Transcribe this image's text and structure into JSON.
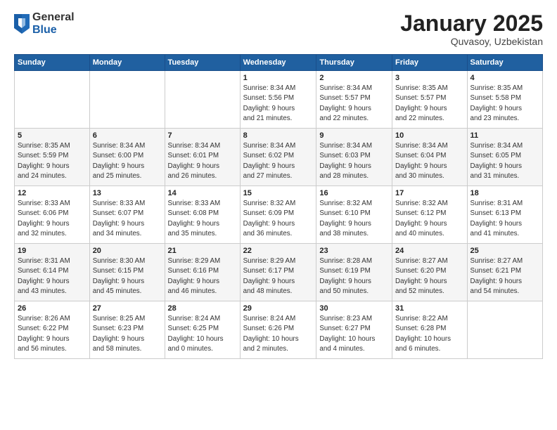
{
  "logo": {
    "general": "General",
    "blue": "Blue"
  },
  "header": {
    "month": "January 2025",
    "location": "Quvasoy, Uzbekistan"
  },
  "weekdays": [
    "Sunday",
    "Monday",
    "Tuesday",
    "Wednesday",
    "Thursday",
    "Friday",
    "Saturday"
  ],
  "weeks": [
    [
      {
        "day": "",
        "info": ""
      },
      {
        "day": "",
        "info": ""
      },
      {
        "day": "",
        "info": ""
      },
      {
        "day": "1",
        "info": "Sunrise: 8:34 AM\nSunset: 5:56 PM\nDaylight: 9 hours\nand 21 minutes."
      },
      {
        "day": "2",
        "info": "Sunrise: 8:34 AM\nSunset: 5:57 PM\nDaylight: 9 hours\nand 22 minutes."
      },
      {
        "day": "3",
        "info": "Sunrise: 8:35 AM\nSunset: 5:57 PM\nDaylight: 9 hours\nand 22 minutes."
      },
      {
        "day": "4",
        "info": "Sunrise: 8:35 AM\nSunset: 5:58 PM\nDaylight: 9 hours\nand 23 minutes."
      }
    ],
    [
      {
        "day": "5",
        "info": "Sunrise: 8:35 AM\nSunset: 5:59 PM\nDaylight: 9 hours\nand 24 minutes."
      },
      {
        "day": "6",
        "info": "Sunrise: 8:34 AM\nSunset: 6:00 PM\nDaylight: 9 hours\nand 25 minutes."
      },
      {
        "day": "7",
        "info": "Sunrise: 8:34 AM\nSunset: 6:01 PM\nDaylight: 9 hours\nand 26 minutes."
      },
      {
        "day": "8",
        "info": "Sunrise: 8:34 AM\nSunset: 6:02 PM\nDaylight: 9 hours\nand 27 minutes."
      },
      {
        "day": "9",
        "info": "Sunrise: 8:34 AM\nSunset: 6:03 PM\nDaylight: 9 hours\nand 28 minutes."
      },
      {
        "day": "10",
        "info": "Sunrise: 8:34 AM\nSunset: 6:04 PM\nDaylight: 9 hours\nand 30 minutes."
      },
      {
        "day": "11",
        "info": "Sunrise: 8:34 AM\nSunset: 6:05 PM\nDaylight: 9 hours\nand 31 minutes."
      }
    ],
    [
      {
        "day": "12",
        "info": "Sunrise: 8:33 AM\nSunset: 6:06 PM\nDaylight: 9 hours\nand 32 minutes."
      },
      {
        "day": "13",
        "info": "Sunrise: 8:33 AM\nSunset: 6:07 PM\nDaylight: 9 hours\nand 34 minutes."
      },
      {
        "day": "14",
        "info": "Sunrise: 8:33 AM\nSunset: 6:08 PM\nDaylight: 9 hours\nand 35 minutes."
      },
      {
        "day": "15",
        "info": "Sunrise: 8:32 AM\nSunset: 6:09 PM\nDaylight: 9 hours\nand 36 minutes."
      },
      {
        "day": "16",
        "info": "Sunrise: 8:32 AM\nSunset: 6:10 PM\nDaylight: 9 hours\nand 38 minutes."
      },
      {
        "day": "17",
        "info": "Sunrise: 8:32 AM\nSunset: 6:12 PM\nDaylight: 9 hours\nand 40 minutes."
      },
      {
        "day": "18",
        "info": "Sunrise: 8:31 AM\nSunset: 6:13 PM\nDaylight: 9 hours\nand 41 minutes."
      }
    ],
    [
      {
        "day": "19",
        "info": "Sunrise: 8:31 AM\nSunset: 6:14 PM\nDaylight: 9 hours\nand 43 minutes."
      },
      {
        "day": "20",
        "info": "Sunrise: 8:30 AM\nSunset: 6:15 PM\nDaylight: 9 hours\nand 45 minutes."
      },
      {
        "day": "21",
        "info": "Sunrise: 8:29 AM\nSunset: 6:16 PM\nDaylight: 9 hours\nand 46 minutes."
      },
      {
        "day": "22",
        "info": "Sunrise: 8:29 AM\nSunset: 6:17 PM\nDaylight: 9 hours\nand 48 minutes."
      },
      {
        "day": "23",
        "info": "Sunrise: 8:28 AM\nSunset: 6:19 PM\nDaylight: 9 hours\nand 50 minutes."
      },
      {
        "day": "24",
        "info": "Sunrise: 8:27 AM\nSunset: 6:20 PM\nDaylight: 9 hours\nand 52 minutes."
      },
      {
        "day": "25",
        "info": "Sunrise: 8:27 AM\nSunset: 6:21 PM\nDaylight: 9 hours\nand 54 minutes."
      }
    ],
    [
      {
        "day": "26",
        "info": "Sunrise: 8:26 AM\nSunset: 6:22 PM\nDaylight: 9 hours\nand 56 minutes."
      },
      {
        "day": "27",
        "info": "Sunrise: 8:25 AM\nSunset: 6:23 PM\nDaylight: 9 hours\nand 58 minutes."
      },
      {
        "day": "28",
        "info": "Sunrise: 8:24 AM\nSunset: 6:25 PM\nDaylight: 10 hours\nand 0 minutes."
      },
      {
        "day": "29",
        "info": "Sunrise: 8:24 AM\nSunset: 6:26 PM\nDaylight: 10 hours\nand 2 minutes."
      },
      {
        "day": "30",
        "info": "Sunrise: 8:23 AM\nSunset: 6:27 PM\nDaylight: 10 hours\nand 4 minutes."
      },
      {
        "day": "31",
        "info": "Sunrise: 8:22 AM\nSunset: 6:28 PM\nDaylight: 10 hours\nand 6 minutes."
      },
      {
        "day": "",
        "info": ""
      }
    ]
  ]
}
